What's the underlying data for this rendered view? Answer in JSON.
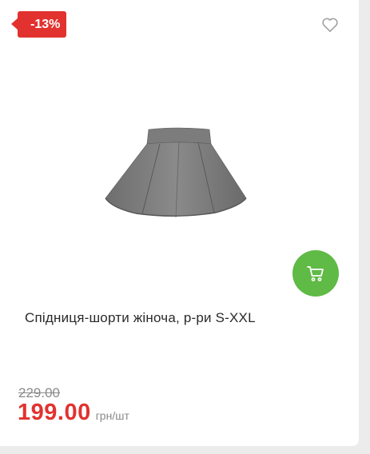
{
  "product": {
    "discount_badge": "-13%",
    "title": "Спідниця-шорти жіноча, р-ри S-XXL",
    "old_price": "229.00",
    "price": "199.00",
    "unit": "грн/шт"
  },
  "icons": {
    "wishlist": "heart-icon",
    "cart": "cart-icon"
  },
  "colors": {
    "accent_red": "#e2322f",
    "cart_green": "#5fba46"
  }
}
